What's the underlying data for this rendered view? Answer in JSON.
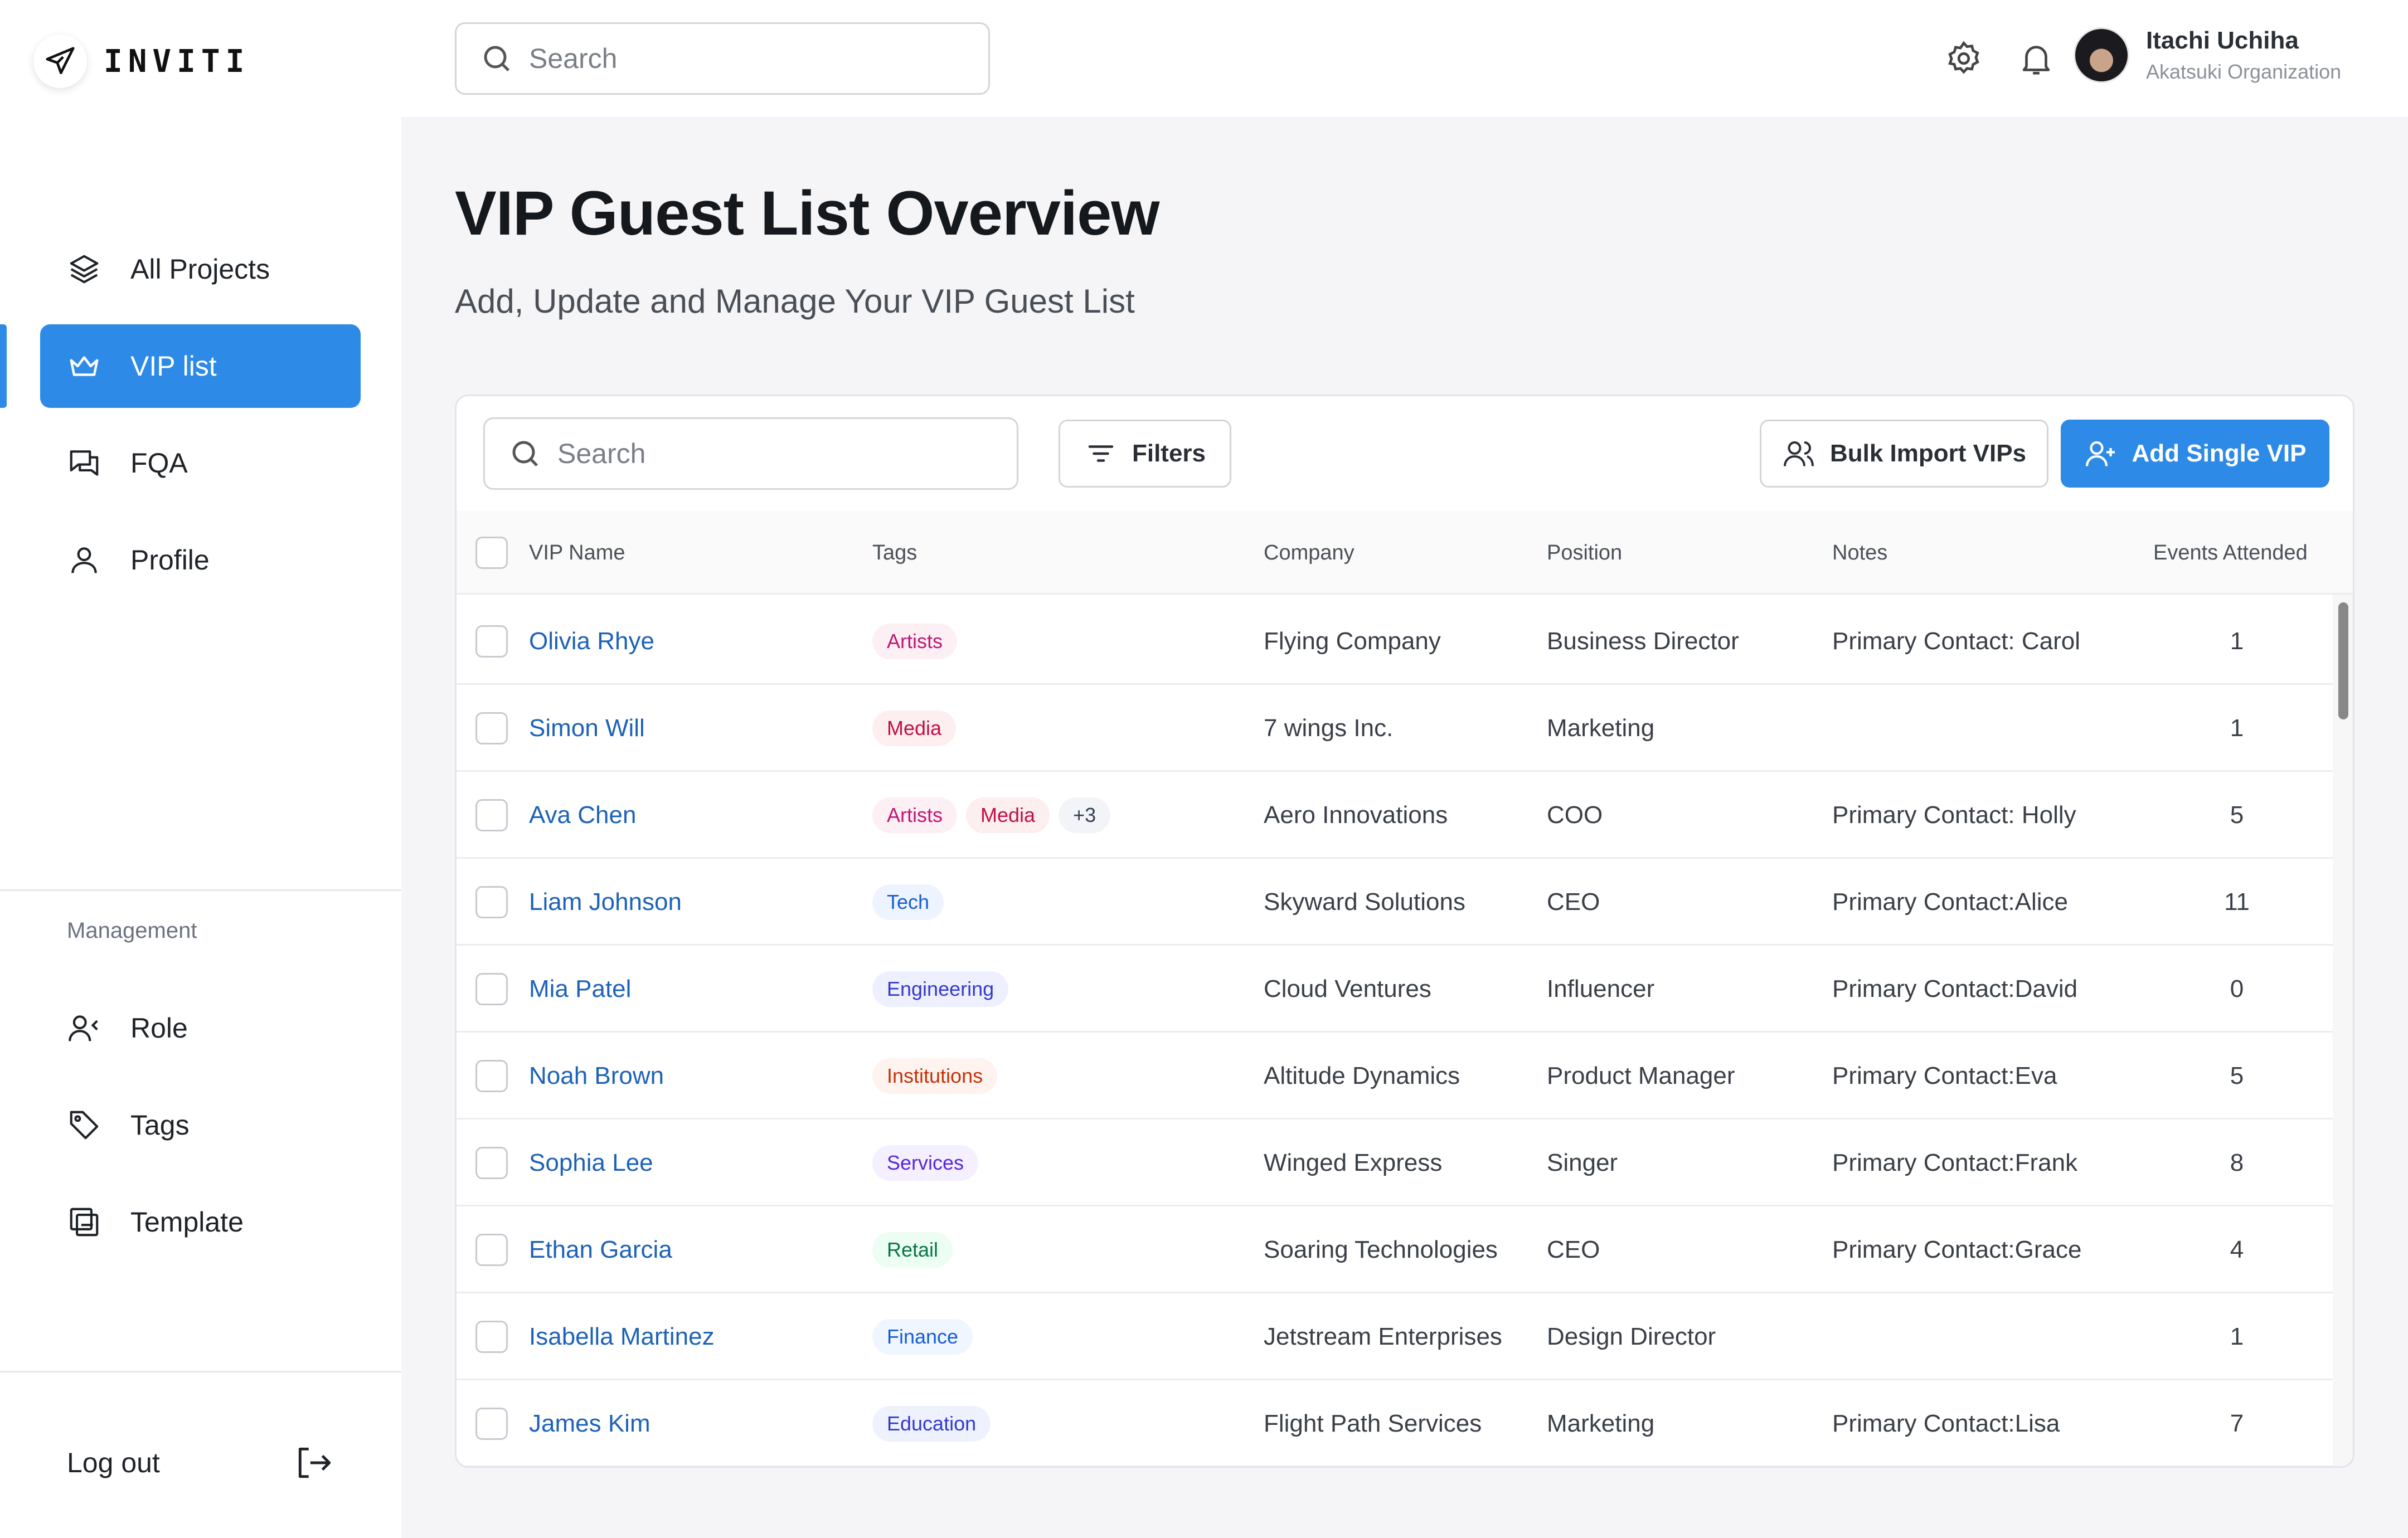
{
  "app": {
    "name": "INVITI"
  },
  "colors": {
    "accent": "#2d8ae6",
    "link": "#1d62b8"
  },
  "sidebar": {
    "items": [
      {
        "label": "All Projects",
        "icon": "layers-icon"
      },
      {
        "label": "VIP list",
        "icon": "crown-icon",
        "active": true
      },
      {
        "label": "FQA",
        "icon": "chat-icon"
      },
      {
        "label": "Profile",
        "icon": "user-icon"
      }
    ],
    "section_label": "Management",
    "management_items": [
      {
        "label": "Role",
        "icon": "users-icon"
      },
      {
        "label": "Tags",
        "icon": "tag-icon"
      },
      {
        "label": "Template",
        "icon": "template-icon"
      }
    ],
    "logout_label": "Log out"
  },
  "topbar": {
    "search_placeholder": "Search",
    "user": {
      "name": "Itachi Uchiha",
      "org": "Akatsuki Organization"
    }
  },
  "page": {
    "title": "VIP Guest List Overview",
    "subtitle": "Add, Update and Manage Your VIP Guest List"
  },
  "toolbar": {
    "search_placeholder": "Search",
    "filters_label": "Filters",
    "bulk_import_label": "Bulk Import VIPs",
    "add_single_label": "Add Single VIP"
  },
  "table": {
    "columns": [
      "VIP Name",
      "Tags",
      "Company",
      "Position",
      "Notes",
      "Events Attended"
    ],
    "rows": [
      {
        "name": "Olivia Rhye",
        "tags": [
          "Artists"
        ],
        "company": "Flying Company",
        "position": "Business Director",
        "notes": "Primary Contact: Carol",
        "events": "1"
      },
      {
        "name": "Simon Will",
        "tags": [
          "Media"
        ],
        "company": "7 wings Inc.",
        "position": "Marketing",
        "notes": "",
        "events": "1"
      },
      {
        "name": "Ava Chen",
        "tags": [
          "Artists",
          "Media",
          "+3"
        ],
        "company": "Aero Innovations",
        "position": "COO",
        "notes": "Primary Contact: Holly",
        "events": "5"
      },
      {
        "name": "Liam Johnson",
        "tags": [
          "Tech"
        ],
        "company": "Skyward Solutions",
        "position": "CEO",
        "notes": "Primary Contact:Alice",
        "events": "11"
      },
      {
        "name": "Mia Patel",
        "tags": [
          "Engineering"
        ],
        "company": "Cloud Ventures",
        "position": "Influencer",
        "notes": "Primary Contact:David",
        "events": "0"
      },
      {
        "name": "Noah Brown",
        "tags": [
          "Institutions"
        ],
        "company": "Altitude Dynamics",
        "position": "Product Manager",
        "notes": "Primary Contact:Eva",
        "events": "5"
      },
      {
        "name": "Sophia Lee",
        "tags": [
          "Services"
        ],
        "company": "Winged Express",
        "position": "Singer",
        "notes": "Primary Contact:Frank",
        "events": "8"
      },
      {
        "name": "Ethan Garcia",
        "tags": [
          "Retail"
        ],
        "company": "Soaring Technologies",
        "position": "CEO",
        "notes": "Primary Contact:Grace",
        "events": "4"
      },
      {
        "name": "Isabella Martinez",
        "tags": [
          "Finance"
        ],
        "company": "Jetstream Enterprises",
        "position": "Design Director",
        "notes": "",
        "events": "1"
      },
      {
        "name": "James Kim",
        "tags": [
          "Education"
        ],
        "company": "Flight Path Services",
        "position": "Marketing",
        "notes": "Primary Contact:Lisa",
        "events": "7"
      }
    ]
  },
  "tag_colors": {
    "Artists": {
      "bg": "#fdf0f5",
      "fg": "#c11574"
    },
    "Media": {
      "bg": "#fdeef0",
      "fg": "#c01048"
    },
    "+3": {
      "bg": "#f2f4f7",
      "fg": "#344054"
    },
    "Tech": {
      "bg": "#eef4ff",
      "fg": "#175cd3"
    },
    "Engineering": {
      "bg": "#eef0ff",
      "fg": "#3538cd"
    },
    "Institutions": {
      "bg": "#fef3ee",
      "fg": "#c4320a"
    },
    "Services": {
      "bg": "#f4f0ff",
      "fg": "#5925dc"
    },
    "Retail": {
      "bg": "#ecfdf3",
      "fg": "#067647"
    },
    "Finance": {
      "bg": "#eff6ff",
      "fg": "#175cd3"
    },
    "Education": {
      "bg": "#eef2ff",
      "fg": "#3538cd"
    }
  }
}
